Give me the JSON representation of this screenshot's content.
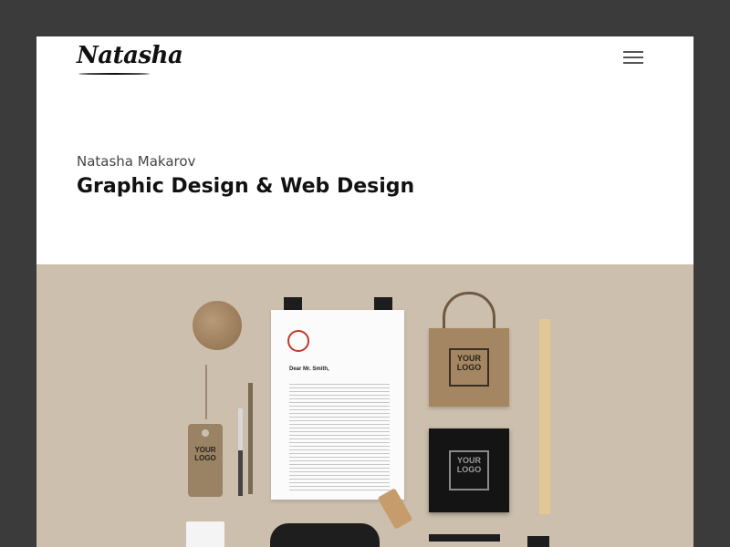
{
  "header": {
    "logo_text": "Natasha",
    "menu_icon": "hamburger-menu-icon"
  },
  "hero": {
    "name": "Natasha Makarov",
    "title": "Graphic Design & Web Design"
  },
  "mockup": {
    "background_color": "#cdbfae",
    "tag_text": "YOUR LOGO",
    "bag_text": "YOUR LOGO",
    "box_text": "YOUR LOGO",
    "letter_greeting": "Dear Mr. Smith,"
  }
}
